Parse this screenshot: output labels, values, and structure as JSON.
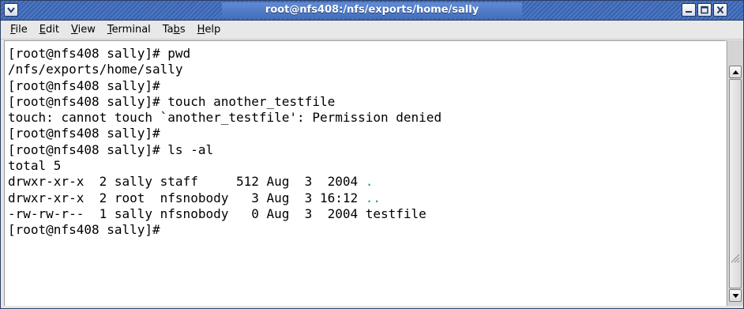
{
  "window": {
    "title": "root@nfs408:/nfs/exports/home/sally"
  },
  "menubar": {
    "items": [
      {
        "label": "File",
        "mnemonic": "F",
        "rest": "ile"
      },
      {
        "label": "Edit",
        "mnemonic": "E",
        "rest": "dit"
      },
      {
        "label": "View",
        "mnemonic": "V",
        "rest": "iew"
      },
      {
        "label": "Terminal",
        "mnemonic": "T",
        "rest": "erminal"
      },
      {
        "label": "Tabs",
        "before": "Ta",
        "mnemonic": "b",
        "rest": "s"
      },
      {
        "label": "Help",
        "mnemonic": "H",
        "rest": "elp"
      }
    ]
  },
  "terminal": {
    "lines": [
      "[root@nfs408 sally]# pwd",
      "/nfs/exports/home/sally",
      "[root@nfs408 sally]#",
      "[root@nfs408 sally]# touch another_testfile",
      "touch: cannot touch `another_testfile': Permission denied",
      "[root@nfs408 sally]#",
      "[root@nfs408 sally]# ls -al",
      "total 5"
    ],
    "listing": [
      {
        "prefix": "drwxr-xr-x  2 sally staff     512 Aug  3  2004 ",
        "name": "."
      },
      {
        "prefix": "drwxr-xr-x  2 root  nfsnobody   3 Aug  3 16:12 ",
        "name": ".."
      },
      {
        "prefix": "-rw-rw-r--  1 sally nfsnobody   0 Aug  3  2004 ",
        "name": "testfile"
      }
    ],
    "prompt_last": "[root@nfs408 sally]#"
  },
  "colors": {
    "titlebar": "#3a62ad",
    "directory_entry": "#1aa64a",
    "terminal_bg": "#ffffff",
    "terminal_fg": "#000000"
  },
  "icons": {
    "window_menu": "chevron-down-icon",
    "minimize": "minimize-icon",
    "maximize": "maximize-icon",
    "close": "close-icon",
    "scroll_up": "arrow-up-icon",
    "scroll_down": "arrow-down-icon"
  }
}
